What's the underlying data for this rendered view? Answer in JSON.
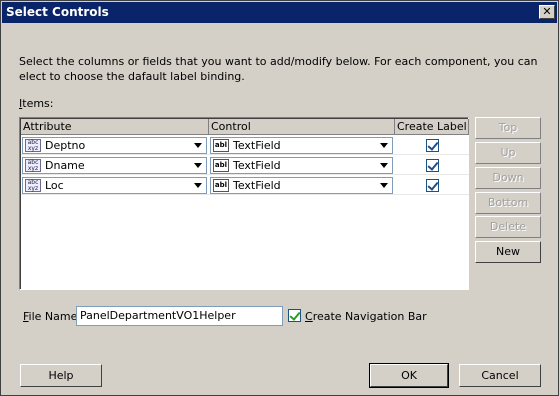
{
  "window": {
    "title": "Select Controls",
    "close_symbol": "✕"
  },
  "instructions": "Select the columns or fields that you want to add/modify below. For each component, you can elect to choose the dafault label binding.",
  "items_label": {
    "mnemonic": "I",
    "rest": "tems:"
  },
  "table": {
    "columns": [
      "Attribute",
      "Control",
      "Create Label"
    ],
    "rows": [
      {
        "attribute": "Deptno",
        "control": "TextField",
        "create_label": true
      },
      {
        "attribute": "Dname",
        "control": "TextField",
        "create_label": true
      },
      {
        "attribute": "Loc",
        "control": "TextField",
        "create_label": true
      }
    ]
  },
  "side_buttons": [
    {
      "label": "Top",
      "enabled": false
    },
    {
      "label": "Up",
      "enabled": false
    },
    {
      "label": "Down",
      "enabled": false
    },
    {
      "label": "Bottom",
      "enabled": false
    },
    {
      "label": "Delete",
      "enabled": false
    },
    {
      "label": "New",
      "enabled": true
    }
  ],
  "file_name": {
    "label_mnemonic": "F",
    "label_rest": "ile Name",
    "value": "PanelDepartmentVO1Helper"
  },
  "navigation_bar": {
    "mnemonic": "C",
    "rest": "reate Navigation Bar",
    "checked": true
  },
  "buttons": {
    "help": "Help",
    "ok": "OK",
    "cancel": "Cancel"
  },
  "icons": {
    "attribute_icon": "abc-xyz-icon",
    "control_icon": "textfield-icon"
  },
  "colors": {
    "titlebar": "#0a246a",
    "dialog_bg": "#d4d0c8"
  }
}
